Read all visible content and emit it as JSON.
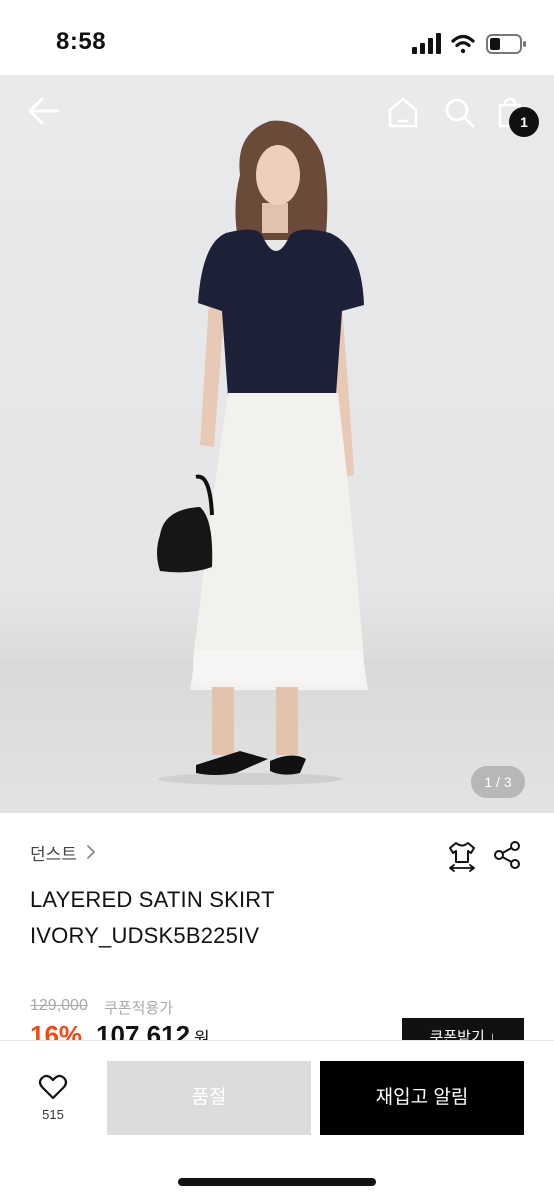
{
  "status_bar": {
    "time": "8:58",
    "icons": [
      "signal-icon",
      "wifi-icon",
      "battery-icon"
    ]
  },
  "header": {
    "back_icon": "arrow-left-icon",
    "home_icon": "home-icon",
    "search_icon": "search-icon",
    "bag_icon": "shopping-bag-icon",
    "cart_count": "1"
  },
  "gallery": {
    "pager": "1 / 3"
  },
  "product": {
    "brand": "던스트",
    "name_line1": "LAYERED SATIN SKIRT",
    "name_line2": "IVORY_UDSK5B225IV",
    "original_price": "129,000",
    "coupon_price_label": "쿠폰적용가",
    "discount": "16%",
    "sale_price": "107,612",
    "currency": "원",
    "price_toggle": "⌄",
    "coupon_button": "쿠폰받기 ↓",
    "fit_icon": "tshirt-size-icon",
    "share_icon": "share-icon"
  },
  "bottom_bar": {
    "like_icon": "heart-icon",
    "like_count": "515",
    "soldout_label": "품절",
    "restock_label": "재입고 알림"
  },
  "colors": {
    "discount": "#f04a12",
    "primary_button": "#000000",
    "disabled_button": "#dcdcdc"
  }
}
